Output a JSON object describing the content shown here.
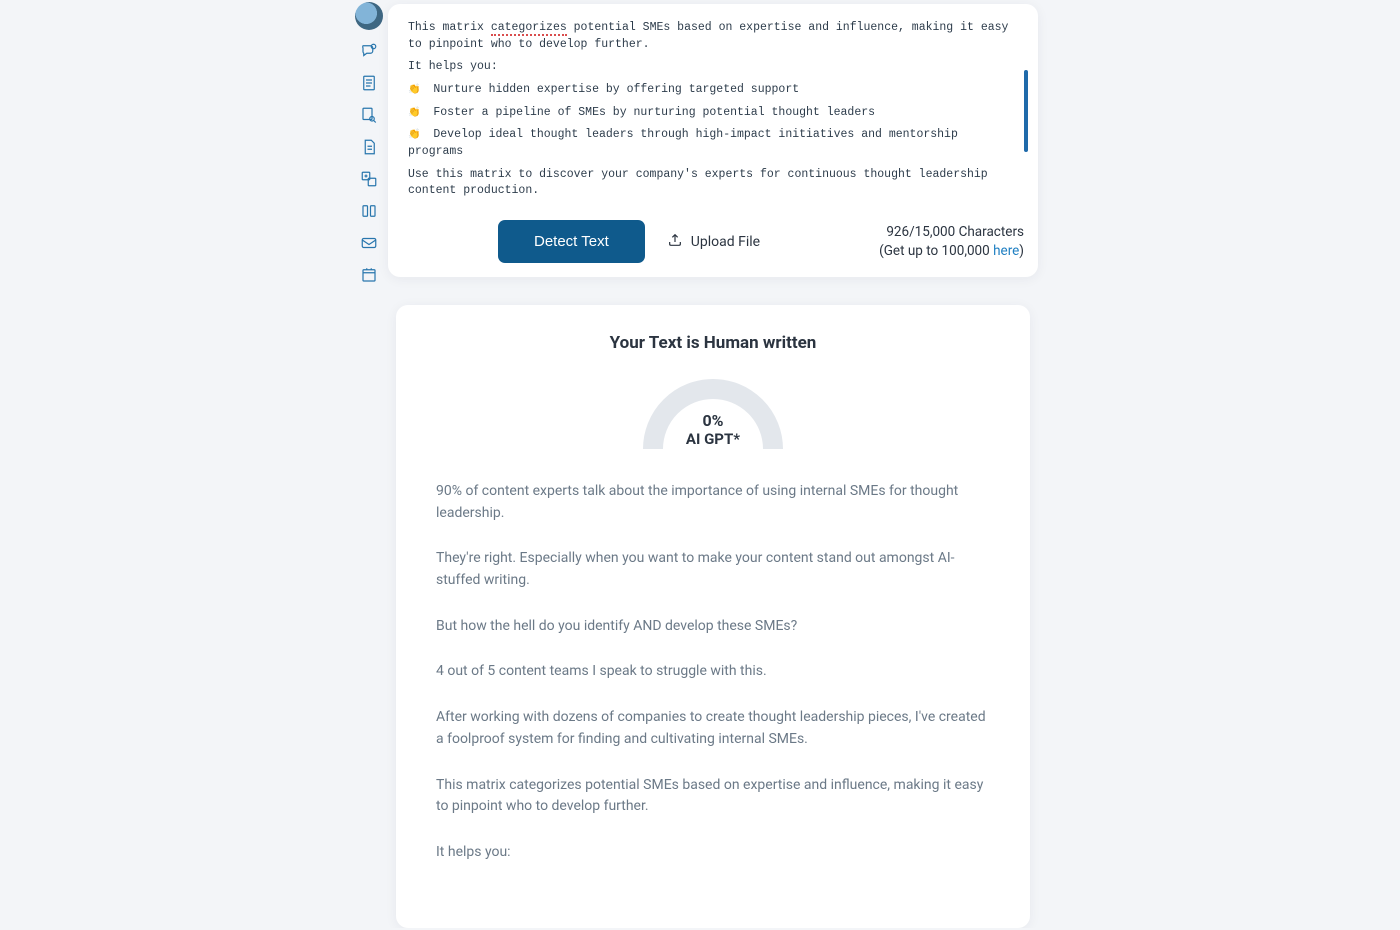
{
  "sidebar": {
    "items": [
      {
        "name": "logo-icon"
      },
      {
        "name": "chat-icon"
      },
      {
        "name": "document-icon"
      },
      {
        "name": "search-doc-icon"
      },
      {
        "name": "page-icon"
      },
      {
        "name": "translate-icon"
      },
      {
        "name": "columns-icon"
      },
      {
        "name": "mail-icon"
      },
      {
        "name": "calendar-icon"
      }
    ]
  },
  "editor": {
    "p1a": "This matrix ",
    "p1_underlined": "categorizes",
    "p1b": " potential SMEs based on expertise and influence, making it easy to pinpoint who to develop further.",
    "p2": "It helps you:",
    "b1": "Nurture hidden expertise by offering targeted support",
    "b2": "Foster a pipeline of SMEs by nurturing potential thought leaders",
    "b3": "Develop ideal thought leaders through high-impact initiatives and mentorship programs",
    "p3": "Use this matrix to discover your company's experts for continuous thought leadership content production."
  },
  "actions": {
    "detect_label": "Detect Text",
    "upload_label": "Upload File"
  },
  "charcount": {
    "line1": "926/15,000 Characters",
    "line2a": "(Get up to 100,000 ",
    "link": "here",
    "line2b": ")"
  },
  "result": {
    "title": "Your Text is Human written",
    "percent": "0%",
    "percent_sub": "AI GPT*",
    "paragraphs": [
      "90% of content experts talk about the importance of using internal SMEs for thought leadership.",
      "They're right. Especially when you want to make your content stand out amongst AI-stuffed writing.",
      "But how the hell do you identify AND develop these SMEs?",
      "4 out of 5 content teams I speak to struggle with this.",
      "After working with dozens of companies to create thought leadership pieces, I've created a foolproof system for finding and cultivating internal SMEs.",
      "This matrix categorizes potential SMEs based on expertise and influence, making it easy to pinpoint who to develop further.",
      "It helps you:"
    ]
  }
}
